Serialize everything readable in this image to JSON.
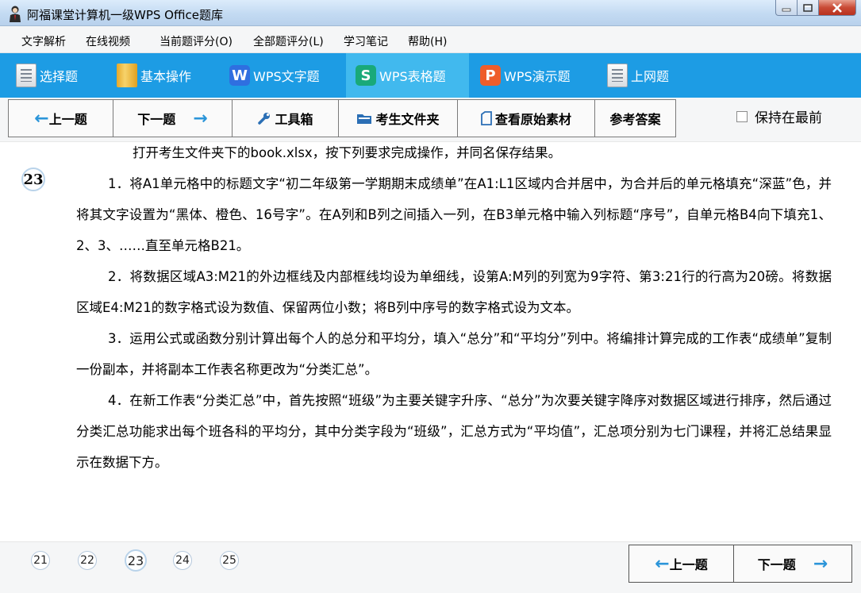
{
  "window": {
    "title": "阿福课堂计算机一级WPS Office题库"
  },
  "menu": {
    "items": [
      "文字解析",
      "在线视频",
      "当前题评分(O)",
      "全部题评分(L)",
      "学习笔记",
      "帮助(H)"
    ]
  },
  "tabs": [
    {
      "label": "选择题",
      "icon": "document-icon"
    },
    {
      "label": "基本操作",
      "icon": "folder-icon"
    },
    {
      "label": "WPS文字题",
      "icon": "wps-writer-icon"
    },
    {
      "label": "WPS表格题",
      "icon": "wps-spreadsheet-icon",
      "active": true
    },
    {
      "label": "WPS演示题",
      "icon": "wps-presentation-icon"
    },
    {
      "label": "上网题",
      "icon": "document-icon"
    }
  ],
  "toolbar": {
    "prev_label": "上一题",
    "next_label": "下一题",
    "toolbox_label": "工具箱",
    "student_folder_label": "考生文件夹",
    "view_material_label": "查看原始素材",
    "reference_answer_label": "参考答案",
    "keep_on_top_label": "保持在最前",
    "keep_on_top_checked": false
  },
  "question": {
    "number": "23",
    "intro": "打开考生文件夹下的book.xlsx，按下列要求完成操作，并同名保存结果。",
    "paragraphs": [
      "1．将A1单元格中的标题文字“初二年级第一学期期末成绩单”在A1:L1区域内合并居中，为合并后的单元格填充“深蓝”色，并将其文字设置为“黑体、橙色、16号字”。在A列和B列之间插入一列，在B3单元格中输入列标题“序号”，自单元格B4向下填充1、2、3、……直至单元格B21。",
      "2．将数据区域A3:M21的外边框线及内部框线均设为单细线，设第A:M列的列宽为9字符、第3:21行的行高为20磅。将数据区域E4:M21的数字格式设为数值、保留两位小数；将B列中序号的数字格式设为文本。",
      "3．运用公式或函数分别计算出每个人的总分和平均分，填入“总分”和“平均分”列中。将编排计算完成的工作表“成绩单”复制一份副本，并将副本工作表名称更改为“分类汇总”。",
      "4．在新工作表“分类汇总”中，首先按照“班级”为主要关键字升序、“总分”为次要关键字降序对数据区域进行排序，然后通过分类汇总功能求出每个班各科的平均分，其中分类字段为“班级”，汇总方式为“平均值”，汇总项分别为七门课程，并将汇总结果显示在数据下方。"
    ]
  },
  "pager": {
    "numbers": [
      "21",
      "22",
      "23",
      "24",
      "25"
    ],
    "current": "23",
    "prev_label": "上一题",
    "next_label": "下一题"
  },
  "colors": {
    "tabbar": "#1d9ce4",
    "tab_active": "#41b9ee",
    "arrow": "#2b95d9"
  }
}
